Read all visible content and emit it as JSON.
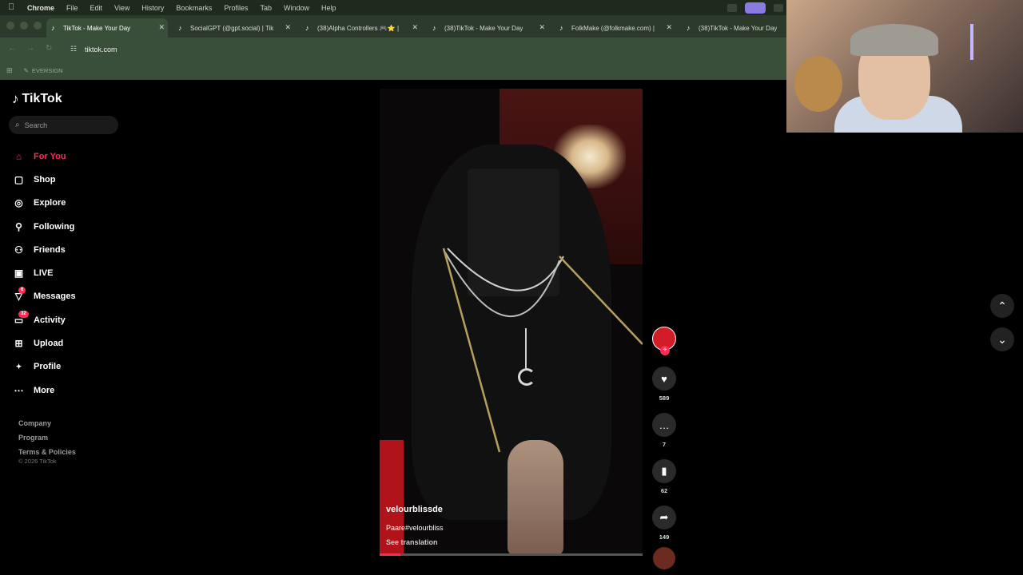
{
  "menubar": {
    "items": [
      "Chrome",
      "File",
      "Edit",
      "View",
      "History",
      "Bookmarks",
      "Profiles",
      "Tab",
      "Window",
      "Help"
    ]
  },
  "tabs": [
    {
      "title": "TikTok - Make Your Day",
      "active": true
    },
    {
      "title": "SocialGPT (@gpt.social) | Tik",
      "active": false
    },
    {
      "title": "(38)Alpha Controllers 🎮⭐ |",
      "active": false
    },
    {
      "title": "(38)TikTok - Make Your Day",
      "active": false
    },
    {
      "title": "FolkMake (@folkmake.com) |",
      "active": false
    },
    {
      "title": "(38)TikTok - Make Your Day",
      "active": false
    }
  ],
  "address": {
    "url": "tiktok.com"
  },
  "bookmarks": {
    "items": [
      "EVERSIGN"
    ]
  },
  "sidebar": {
    "logo": "TikTok",
    "search_placeholder": "Search",
    "nav": [
      {
        "label": "For You",
        "icon": "home-icon",
        "active": true
      },
      {
        "label": "Shop",
        "icon": "shop-bag-icon"
      },
      {
        "label": "Explore",
        "icon": "compass-icon"
      },
      {
        "label": "Following",
        "icon": "following-icon"
      },
      {
        "label": "Friends",
        "icon": "friends-icon"
      },
      {
        "label": "LIVE",
        "icon": "live-icon"
      },
      {
        "label": "Messages",
        "icon": "messages-icon",
        "badge": "6"
      },
      {
        "label": "Activity",
        "icon": "activity-icon",
        "badge": "32"
      },
      {
        "label": "Upload",
        "icon": "upload-icon"
      },
      {
        "label": "Profile",
        "icon": "profile-icon"
      },
      {
        "label": "More",
        "icon": "more-icon"
      }
    ],
    "footer": [
      "Company",
      "Program",
      "Terms & Policies"
    ],
    "copyright": "© 2026 TikTok"
  },
  "video": {
    "author": "velourblissde",
    "description": "Paare#velourbliss",
    "see_translation": "See translation",
    "progress": 0.08
  },
  "actions": {
    "likes": "589",
    "comments": "7",
    "saves": "62",
    "shares": "149"
  },
  "colors": {
    "accent": "#fe2c55",
    "chrome": "#3a4f3a"
  }
}
